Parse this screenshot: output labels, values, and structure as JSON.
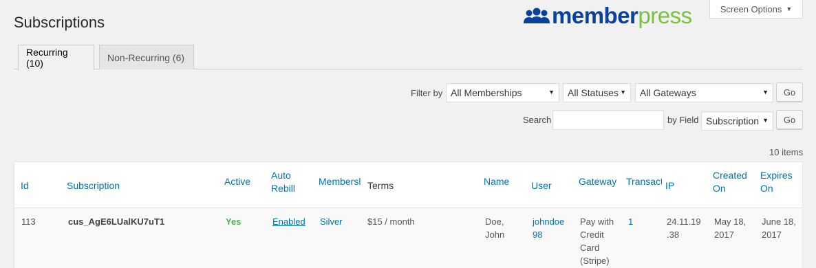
{
  "page": {
    "title": "Subscriptions"
  },
  "logo": {
    "part1": "member",
    "part2": "press"
  },
  "screen_options": {
    "label": "Screen Options"
  },
  "tabs": [
    {
      "label": "Recurring (10)",
      "active": true
    },
    {
      "label": "Non-Recurring (6)",
      "active": false
    }
  ],
  "filters": {
    "filter_by_label": "Filter by",
    "membership": "All Memberships",
    "status": "All Statuses",
    "gateway": "All Gateways",
    "go_label": "Go"
  },
  "search": {
    "label": "Search",
    "value": "",
    "by_field_label": "by Field",
    "field": "Subscription",
    "go_label": "Go"
  },
  "items_count": "10 items",
  "table": {
    "headers": {
      "id": "Id",
      "subscription": "Subscription",
      "active": "Active",
      "auto_rebill_1": "Auto",
      "auto_rebill_2": "Rebill",
      "membership": "Membersl",
      "terms": "Terms",
      "name": "Name",
      "user": "User",
      "gateway": "Gateway",
      "transactions": "Transact",
      "ip": "IP",
      "created_1": "Created",
      "created_2": "On",
      "expires_1": "Expires",
      "expires_2": "On"
    },
    "rows": [
      {
        "id": "113",
        "subscription": "cus_AgE6LUalKU7uT1",
        "active": "Yes",
        "auto_rebill": "Enabled",
        "membership": "Silver",
        "terms": "$15 / month",
        "name_1": "Doe,",
        "name_2": "John",
        "user_1": "johndoe",
        "user_2": "98",
        "gateway_1": "Pay with",
        "gateway_2": "Credit",
        "gateway_3": "Card",
        "gateway_4": "(Stripe)",
        "transactions": "1",
        "ip_1": "24.11.19",
        "ip_2": ".38",
        "created_1": "May 18,",
        "created_2": "2017",
        "expires_1": "June 18,",
        "expires_2": "2017"
      }
    ]
  },
  "colors": {
    "link": "#0073aa",
    "brand_blue": "#06429e",
    "brand_green": "#7ac143",
    "active_green": "#46b450"
  }
}
